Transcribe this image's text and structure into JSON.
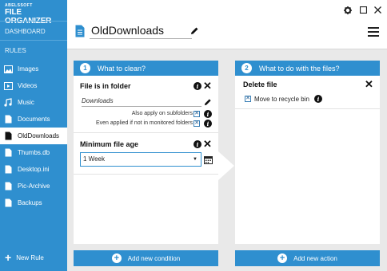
{
  "app": {
    "logo_top": "ABELSSOFT",
    "logo_main": "FILE ORGANIZER"
  },
  "sidebar": {
    "dashboard_label": "DASHBOARD",
    "rules_label": "RULES",
    "items": [
      {
        "label": "Images",
        "icon": "image-icon"
      },
      {
        "label": "Videos",
        "icon": "video-icon"
      },
      {
        "label": "Music",
        "icon": "music-icon"
      },
      {
        "label": "Documents",
        "icon": "document-icon"
      },
      {
        "label": "OldDownloads",
        "icon": "document-icon",
        "active": true
      },
      {
        "label": "Thumbs.db",
        "icon": "document-icon"
      },
      {
        "label": "Desktop.ini",
        "icon": "document-icon"
      },
      {
        "label": "Pic-Archive",
        "icon": "document-icon"
      },
      {
        "label": "Backups",
        "icon": "document-icon"
      }
    ],
    "new_rule_label": "New Rule"
  },
  "header": {
    "rule_name": "OldDownloads"
  },
  "left_panel": {
    "step": "1",
    "title": "What to clean?",
    "folder_card": {
      "title": "File is in folder",
      "folder_value": "Downloads",
      "option_subfolders": "Also apply on subfolders",
      "option_subfolders_checked": true,
      "option_unmonitored": "Even applied if not in monitored folders",
      "option_unmonitored_checked": true
    },
    "age_card": {
      "title": "Minimum file age",
      "selected_value": "1 Week"
    },
    "add_button": "Add new condition"
  },
  "right_panel": {
    "step": "2",
    "title": "What to do with the files?",
    "delete_card": {
      "title": "Delete file",
      "option_recycle": "Move to recycle bin",
      "option_recycle_checked": true
    },
    "add_button": "Add new action"
  },
  "colors": {
    "accent": "#2f8fcf",
    "background": "#e9e9e9"
  }
}
